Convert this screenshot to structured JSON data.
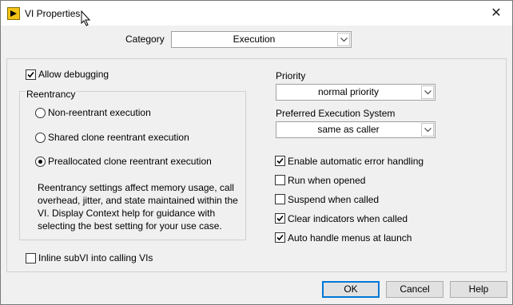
{
  "window": {
    "title": "VI Properties",
    "close_glyph": "✕"
  },
  "category": {
    "label": "Category",
    "value": "Execution"
  },
  "allow_debugging": {
    "label": "Allow debugging",
    "checked": true
  },
  "reentrancy": {
    "group_label": "Reentrancy",
    "options": [
      {
        "label": "Non-reentrant execution",
        "selected": false
      },
      {
        "label": "Shared clone reentrant execution",
        "selected": false
      },
      {
        "label": "Preallocated clone reentrant execution",
        "selected": true
      }
    ],
    "note": "Reentrancy settings affect memory usage, call overhead, jitter, and state maintained within the VI. Display Context help for guidance with selecting the best setting for your use case."
  },
  "inline_subvi": {
    "label": "Inline subVI into calling VIs",
    "checked": false
  },
  "priority": {
    "label": "Priority",
    "value": "normal priority"
  },
  "execution_system": {
    "label": "Preferred Execution System",
    "value": "same as caller"
  },
  "options": [
    {
      "label": "Enable automatic error handling",
      "checked": true
    },
    {
      "label": "Run when opened",
      "checked": false
    },
    {
      "label": "Suspend when called",
      "checked": false
    },
    {
      "label": "Clear indicators when called",
      "checked": true
    },
    {
      "label": "Auto handle menus at launch",
      "checked": true
    }
  ],
  "buttons": {
    "ok": "OK",
    "cancel": "Cancel",
    "help": "Help"
  },
  "colors": {
    "accent": "#0078d7",
    "app_icon": "#f3c315"
  }
}
